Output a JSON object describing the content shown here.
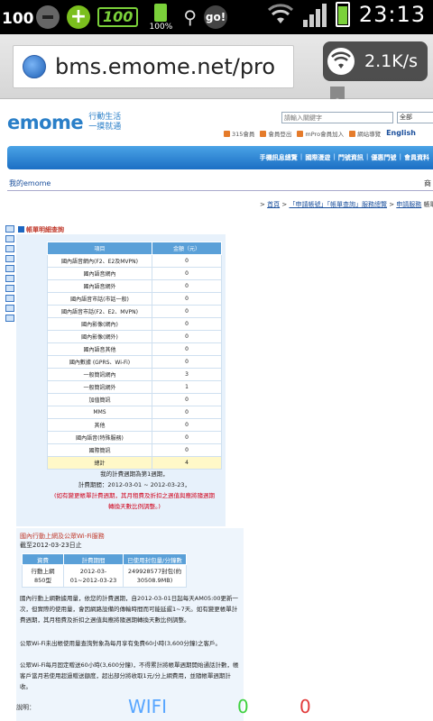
{
  "status_bar": {
    "left_number": "100",
    "battery_widget_value": "100",
    "battery_percent": "100%",
    "clock": "23:13",
    "go_icon_text": "go!"
  },
  "browser": {
    "url": "bms.emome.net/pro",
    "speed": "2.1K/s"
  },
  "site": {
    "logo_text": "emome",
    "tagline_line1": "行動生活",
    "tagline_line2": "一摸就通",
    "search_placeholder": "請輸入關鍵字",
    "search_scope": "全部",
    "top_links": [
      "315會員",
      "會員登出",
      "mPro會員加入",
      "網站導覽"
    ],
    "english_label": "English",
    "nav_items": [
      "手機訊息總覽",
      "國際漫遊",
      "門號資訊",
      "優惠門號",
      "會員資料"
    ],
    "my_emome": "我的emome",
    "my_emome_right": "商",
    "breadcrumb": [
      ">",
      "首頁",
      ">",
      "「申請帳號」「帳單查詢」服務總覽",
      ">",
      "申請服務",
      "帳單"
    ]
  },
  "fee_section": {
    "title": "帳單明細查詢",
    "columns": [
      "項目",
      "金額（元）"
    ],
    "rows": [
      {
        "item": "國內語音網內(F2、E2及MVPN)",
        "amount": "0"
      },
      {
        "item": "國內語音網內",
        "amount": "0"
      },
      {
        "item": "國內語音網外",
        "amount": "0"
      },
      {
        "item": "國內語音市話(市話一般)",
        "amount": "0"
      },
      {
        "item": "國內語音市話(F2、E2、MVPN)",
        "amount": "0"
      },
      {
        "item": "國內影像(網內)",
        "amount": "0"
      },
      {
        "item": "國內影像(網外)",
        "amount": "0"
      },
      {
        "item": "國內語音其他",
        "amount": "0"
      },
      {
        "item": "國內數據 (GPRS、Wi-Fi)",
        "amount": "0"
      },
      {
        "item": "一般簡訊網內",
        "amount": "3"
      },
      {
        "item": "一般簡訊網外",
        "amount": "1"
      },
      {
        "item": "加值簡訊",
        "amount": "0"
      },
      {
        "item": "MMS",
        "amount": "0"
      },
      {
        "item": "其他",
        "amount": "0"
      },
      {
        "item": "國內語音(特殊服務)",
        "amount": "0"
      },
      {
        "item": "國際簡訊",
        "amount": "0"
      }
    ],
    "total_label": "總計",
    "total_amount": "4",
    "note_line1": "我的計費週期為第1週期，",
    "note_line2": "計費期間：2012-03-01 ~ 2012-03-23，",
    "note_red1": "(如有變更帳單計費週期，其月租費及折扣之週值與應將隨週期",
    "note_red2": "轉換天數比例調整。)"
  },
  "wifi_section": {
    "title": "國內行動上網及公眾Wi-Fi服務",
    "date": "截至2012-03-23日止",
    "columns": [
      "資費",
      "計費期間",
      "已使用封包量/分鐘數"
    ],
    "row": {
      "plan": "行動上網 850型",
      "period": "2012-03-01~2012-03-23",
      "usage": "249928577封包(約30508.9MB)"
    },
    "para1": "國內行動上網數據用量，依您的計費週期，自2012-03-01日起每天AM05:00更新一次，但實際的使用量，會因網路設備的傳輸時間而可能延遲1~7天。如有變更帳單計費週期，其月租費及折扣之週值與應將隨週期轉換天數比例調整。",
    "para2": "公眾Wi-Fi未出帳使用量查詢對象為每月享有免費60小時(3,600分鐘)之客戶。",
    "para3": "公眾Wi-Fi每月固定贈送60小時(3,600分鐘)，不得累計將帳單週期開始通話計數，帳客戶當月若使用超過贈送額度，超出部分將收取1元/分上網費用，並隨帳單週期計收。",
    "notes_label": "說明："
  },
  "overlay": {
    "wifi_label": "WIFI",
    "green_value": "0",
    "red_value": "0"
  }
}
